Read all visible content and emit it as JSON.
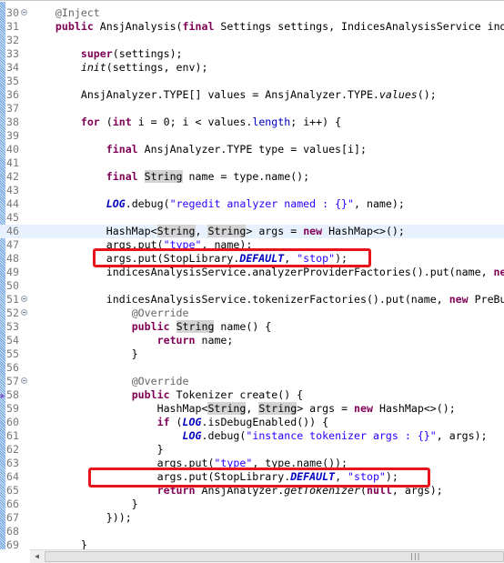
{
  "editor": {
    "first_line": 30,
    "current_line": 46,
    "fold_lines": [
      30,
      51,
      52,
      57
    ],
    "marker_lines": [
      58
    ],
    "highlight_color": "#e8f2fe",
    "annotation_color": "#e8141c",
    "scrollbar": {
      "left_arrow": "◀",
      "grip": "|||"
    },
    "lines": [
      {
        "n": "30",
        "t": [
          [
            "    ",
            ""
          ],
          [
            "@Inject",
            "ann"
          ]
        ]
      },
      {
        "n": "31",
        "t": [
          [
            "    ",
            ""
          ],
          [
            "public",
            "kw"
          ],
          [
            " AnsjAnalysis(",
            ""
          ],
          [
            "final",
            "kw"
          ],
          [
            " Settings settings, IndicesAnalysisService ind",
            ""
          ]
        ]
      },
      {
        "n": "32",
        "t": []
      },
      {
        "n": "33",
        "t": [
          [
            "        ",
            ""
          ],
          [
            "super",
            "kw"
          ],
          [
            "(settings);",
            ""
          ]
        ]
      },
      {
        "n": "34",
        "t": [
          [
            "        ",
            ""
          ],
          [
            "init",
            "it"
          ],
          [
            "(settings, env);",
            ""
          ]
        ]
      },
      {
        "n": "35",
        "t": []
      },
      {
        "n": "36",
        "t": [
          [
            "        AnsjAnalyzer.TYPE[] values = AnsjAnalyzer.TYPE.",
            ""
          ],
          [
            "values",
            "it"
          ],
          [
            "();",
            ""
          ]
        ]
      },
      {
        "n": "37",
        "t": []
      },
      {
        "n": "38",
        "t": [
          [
            "        ",
            ""
          ],
          [
            "for",
            "kw"
          ],
          [
            " (",
            ""
          ],
          [
            "int",
            "kw"
          ],
          [
            " i = 0; i < values.",
            ""
          ],
          [
            "length",
            "fld"
          ],
          [
            "; i++) {",
            ""
          ]
        ]
      },
      {
        "n": "39",
        "t": []
      },
      {
        "n": "40",
        "t": [
          [
            "            ",
            ""
          ],
          [
            "final",
            "kw"
          ],
          [
            " AnsjAnalyzer.TYPE type = values[i];",
            ""
          ]
        ]
      },
      {
        "n": "41",
        "t": []
      },
      {
        "n": "42",
        "t": [
          [
            "            ",
            ""
          ],
          [
            "final",
            "kw"
          ],
          [
            " ",
            ""
          ],
          [
            "String",
            "occ"
          ],
          [
            " name = type.name();",
            ""
          ]
        ]
      },
      {
        "n": "43",
        "t": []
      },
      {
        "n": "44",
        "t": [
          [
            "            ",
            ""
          ],
          [
            "LOG",
            "sfld"
          ],
          [
            ".debug(",
            ""
          ],
          [
            "\"regedit analyzer named : {}\"",
            "str"
          ],
          [
            ", name);",
            ""
          ]
        ]
      },
      {
        "n": "45",
        "t": []
      },
      {
        "n": "46",
        "t": [
          [
            "            HashMap<",
            ""
          ],
          [
            "String",
            "occ"
          ],
          [
            ", ",
            ""
          ],
          [
            "String",
            "occ"
          ],
          [
            "> args = ",
            ""
          ],
          [
            "new",
            "kw"
          ],
          [
            " HashMap<>();",
            ""
          ]
        ]
      },
      {
        "n": "47",
        "t": [
          [
            "            args.put(",
            ""
          ],
          [
            "\"type\"",
            "str"
          ],
          [
            ", name);",
            ""
          ]
        ]
      },
      {
        "n": "48",
        "t": [
          [
            "            args.put(StopLibrary.",
            ""
          ],
          [
            "DEFAULT",
            "sfld"
          ],
          [
            ", ",
            ""
          ],
          [
            "\"stop\"",
            "str"
          ],
          [
            ");",
            ""
          ]
        ]
      },
      {
        "n": "49",
        "t": [
          [
            "            indicesAnalysisService.analyzerProviderFactories().put(name, ",
            ""
          ],
          [
            "ne",
            "kw"
          ]
        ]
      },
      {
        "n": "50",
        "t": []
      },
      {
        "n": "51",
        "t": [
          [
            "            indicesAnalysisService.tokenizerFactories().put(name, ",
            ""
          ],
          [
            "new",
            "kw"
          ],
          [
            " PreBu",
            ""
          ]
        ]
      },
      {
        "n": "52",
        "t": [
          [
            "                ",
            ""
          ],
          [
            "@Override",
            "ann"
          ]
        ]
      },
      {
        "n": "53",
        "t": [
          [
            "                ",
            ""
          ],
          [
            "public",
            "kw"
          ],
          [
            " ",
            ""
          ],
          [
            "String",
            "occ"
          ],
          [
            " name() {",
            ""
          ]
        ]
      },
      {
        "n": "54",
        "t": [
          [
            "                    ",
            ""
          ],
          [
            "return",
            "kw"
          ],
          [
            " name;",
            ""
          ]
        ]
      },
      {
        "n": "55",
        "t": [
          [
            "                }",
            ""
          ]
        ]
      },
      {
        "n": "56",
        "t": []
      },
      {
        "n": "57",
        "t": [
          [
            "                ",
            ""
          ],
          [
            "@Override",
            "ann"
          ]
        ]
      },
      {
        "n": "58",
        "t": [
          [
            "                ",
            ""
          ],
          [
            "public",
            "kw"
          ],
          [
            " Tokenizer create() {",
            ""
          ]
        ]
      },
      {
        "n": "59",
        "t": [
          [
            "                    HashMap<",
            ""
          ],
          [
            "String",
            "occ"
          ],
          [
            ", ",
            ""
          ],
          [
            "String",
            "occ"
          ],
          [
            "> args = ",
            ""
          ],
          [
            "new",
            "kw"
          ],
          [
            " HashMap<>();",
            ""
          ]
        ]
      },
      {
        "n": "60",
        "t": [
          [
            "                    ",
            ""
          ],
          [
            "if",
            "kw"
          ],
          [
            " (",
            ""
          ],
          [
            "LOG",
            "sfld"
          ],
          [
            ".isDebugEnabled()) {",
            ""
          ]
        ]
      },
      {
        "n": "61",
        "t": [
          [
            "                        ",
            ""
          ],
          [
            "LOG",
            "sfld"
          ],
          [
            ".debug(",
            ""
          ],
          [
            "\"instance tokenizer args : {}\"",
            "str"
          ],
          [
            ", args);",
            ""
          ]
        ]
      },
      {
        "n": "62",
        "t": [
          [
            "                    }",
            ""
          ]
        ]
      },
      {
        "n": "63",
        "t": [
          [
            "                    args.put(",
            ""
          ],
          [
            "\"type\"",
            "str"
          ],
          [
            ", type.name());",
            ""
          ]
        ]
      },
      {
        "n": "64",
        "t": [
          [
            "                    args.put(StopLibrary.",
            ""
          ],
          [
            "DEFAULT",
            "sfld"
          ],
          [
            ", ",
            ""
          ],
          [
            "\"stop\"",
            "str"
          ],
          [
            ");",
            ""
          ]
        ]
      },
      {
        "n": "65",
        "t": [
          [
            "                    ",
            ""
          ],
          [
            "return",
            "kw"
          ],
          [
            " AnsjAnalyzer.",
            ""
          ],
          [
            "getTokenizer",
            "it"
          ],
          [
            "(",
            ""
          ],
          [
            "null",
            "kw"
          ],
          [
            ", args);",
            ""
          ]
        ]
      },
      {
        "n": "66",
        "t": [
          [
            "                }",
            ""
          ]
        ]
      },
      {
        "n": "67",
        "t": [
          [
            "            }));",
            ""
          ]
        ]
      },
      {
        "n": "68",
        "t": []
      },
      {
        "n": "69",
        "t": [
          [
            "        }",
            ""
          ]
        ]
      }
    ]
  }
}
